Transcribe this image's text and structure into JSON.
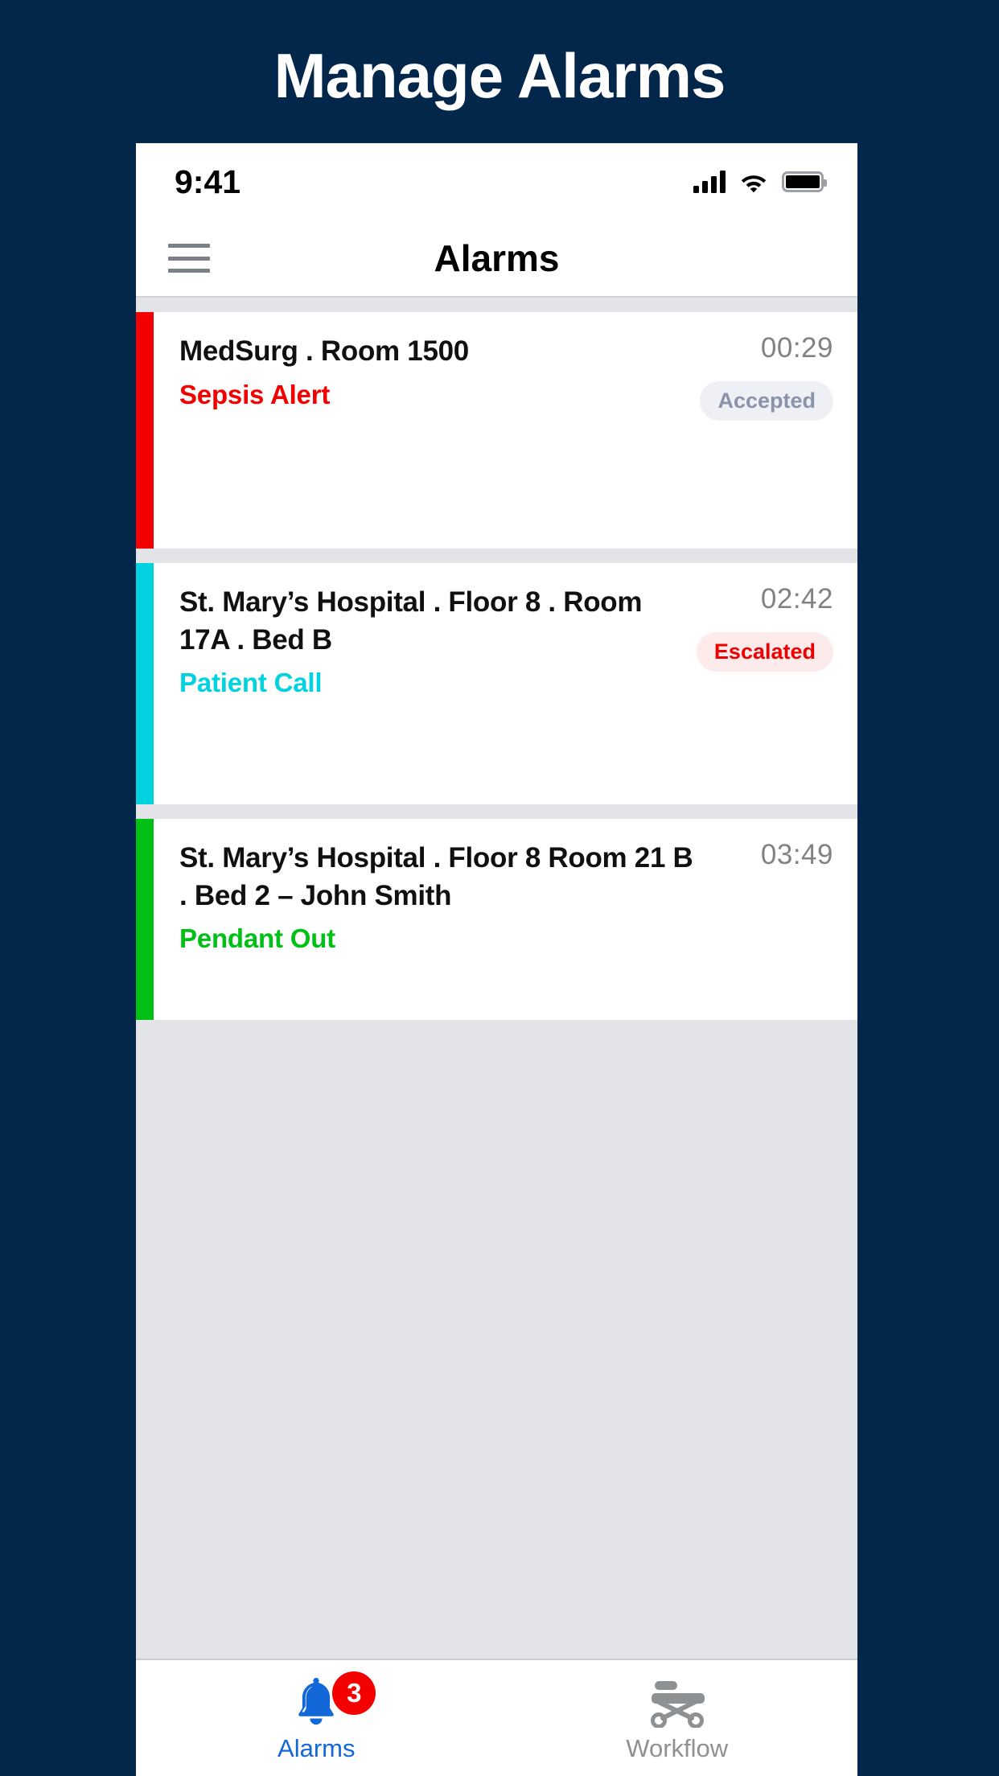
{
  "banner": {
    "title": "Manage Alarms",
    "background": "#03264b"
  },
  "status_bar": {
    "time": "9:41",
    "icons": [
      "cellular-signal-icon",
      "wifi-icon",
      "battery-icon"
    ]
  },
  "nav": {
    "menu_icon": "hamburger-menu-icon",
    "title": "Alarms"
  },
  "alarms": [
    {
      "location": "MedSurg . Room 1500",
      "type": "Sepsis Alert",
      "type_color": "#f20000",
      "accent_color": "#f20000",
      "timer": "00:29",
      "status": "Accepted",
      "status_text_color": "#8b93a8",
      "status_bg_color": "#eef0f5"
    },
    {
      "location": "St. Mary’s Hospital . Floor 8 . Room 17A . Bed B",
      "type": "Patient Call",
      "type_color": "#00d2e0",
      "accent_color": "#00d2e0",
      "timer": "02:42",
      "status": "Escalated",
      "status_text_color": "#ee0000",
      "status_bg_color": "#fdeaea"
    },
    {
      "location": "St. Mary’s Hospital . Floor 8 Room 21 B . Bed 2 – John Smith",
      "type": "Pendant Out",
      "type_color": "#00bf15",
      "accent_color": "#00bf15",
      "timer": "03:49",
      "status": "",
      "status_text_color": "",
      "status_bg_color": ""
    }
  ],
  "tabs": [
    {
      "label": "Alarms",
      "icon": "bell-icon",
      "badge": "3",
      "active": true,
      "color": "#1268d8"
    },
    {
      "label": "Workflow",
      "icon": "stretcher-icon",
      "badge": "",
      "active": false,
      "color": "#8e9194"
    }
  ]
}
